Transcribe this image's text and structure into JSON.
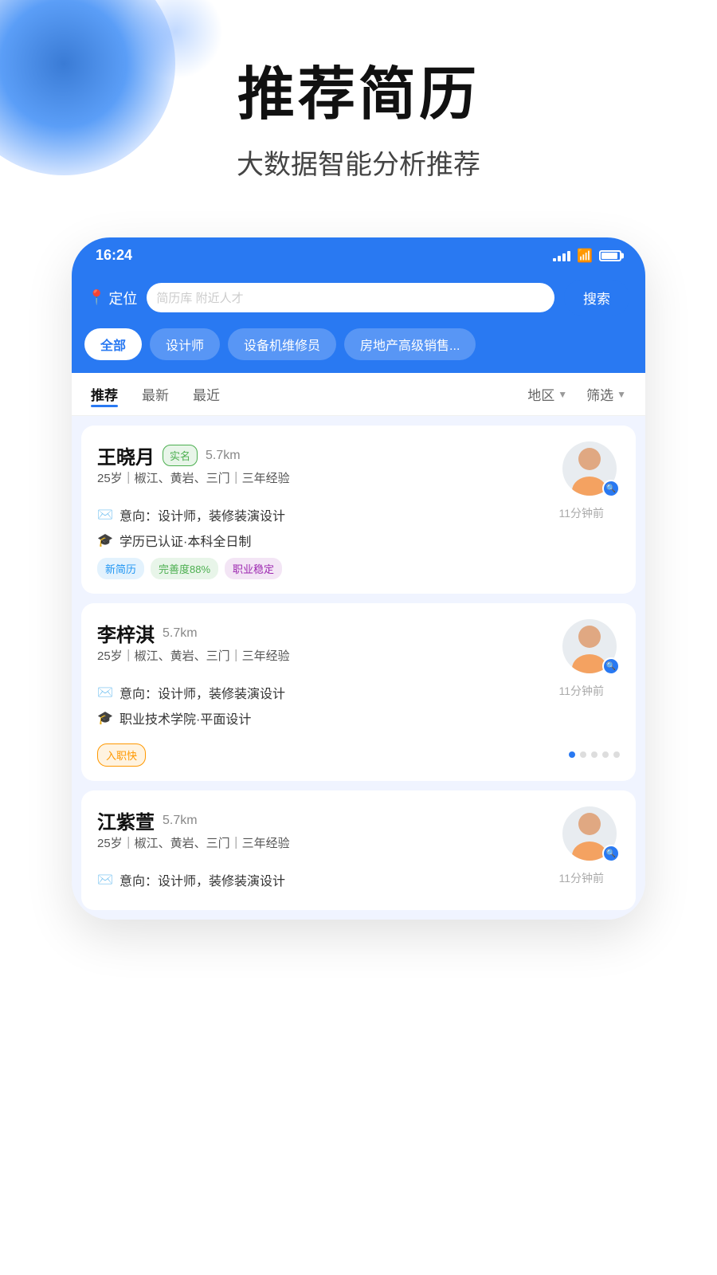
{
  "hero": {
    "title": "推荐简历",
    "subtitle": "大数据智能分析推荐"
  },
  "statusBar": {
    "time": "16:24"
  },
  "searchBar": {
    "location": "定位",
    "placeholder": "简历库  附近人才",
    "searchButton": "搜索"
  },
  "categories": [
    {
      "label": "全部",
      "active": true
    },
    {
      "label": "设计师",
      "active": false
    },
    {
      "label": "设备机维修员",
      "active": false
    },
    {
      "label": "房地产高级销售...",
      "active": false
    }
  ],
  "sortTabs": {
    "items": [
      {
        "label": "推荐",
        "active": true
      },
      {
        "label": "最新",
        "active": false
      },
      {
        "label": "最近",
        "active": false
      }
    ],
    "filters": [
      {
        "label": "地区"
      },
      {
        "label": "筛选"
      }
    ]
  },
  "resumes": [
    {
      "name": "王晓月",
      "verified": "实名",
      "distance": "5.7km",
      "age": "25岁",
      "location": "椒江、黄岩、三门",
      "experience": "三年经验",
      "intention": "意向：设计师，装修装演设计",
      "education": "学历已认证·本科全日制",
      "time": "11分钟前",
      "tags": [
        {
          "label": "新简历",
          "type": "new"
        },
        {
          "label": "完善度88%",
          "type": "complete"
        },
        {
          "label": "职业稳定",
          "type": "stable"
        }
      ],
      "hasDots": false
    },
    {
      "name": "李梓淇",
      "verified": "",
      "distance": "5.7km",
      "age": "25岁",
      "location": "椒江、黄岩、三门",
      "experience": "三年经验",
      "intention": "意向：设计师，装修装演设计",
      "education": "职业技术学院·平面设计",
      "time": "11分钟前",
      "tags": [
        {
          "label": "入职快",
          "type": "fast"
        }
      ],
      "hasDots": true
    },
    {
      "name": "江紫萱",
      "verified": "",
      "distance": "5.7km",
      "age": "25岁",
      "location": "椒江、黄岩、三门",
      "experience": "三年经验",
      "intention": "意向：设计师，装修装演设计",
      "education": "",
      "time": "11分钟前",
      "tags": [],
      "hasDots": false,
      "partial": true
    }
  ],
  "colors": {
    "primary": "#2979f2",
    "primaryLight": "#e3f2fd",
    "white": "#ffffff",
    "textDark": "#111111",
    "textGray": "#888888"
  }
}
